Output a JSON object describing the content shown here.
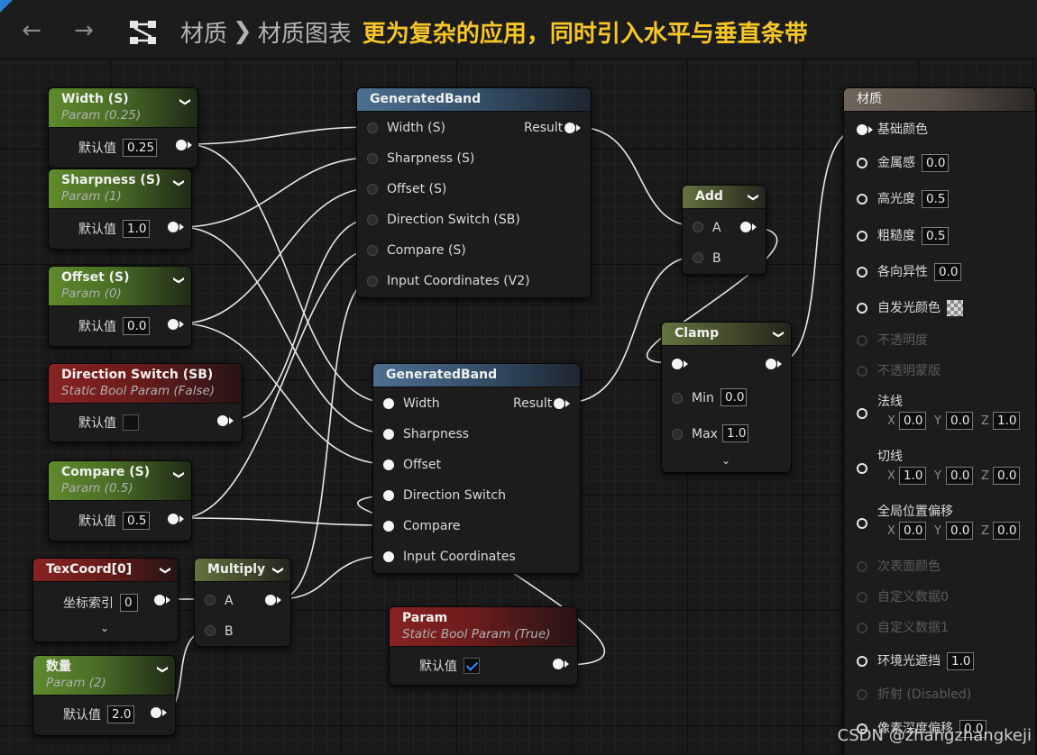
{
  "breadcrumb": {
    "root": "材质",
    "current": "材质图表",
    "caption": "更为复杂的应用，同时引入水平与垂直条带"
  },
  "nodes": {
    "width_param": {
      "title": "Width (S)",
      "subtitle": "Param (0.25)",
      "field_label": "默认值",
      "value": "0.25"
    },
    "sharpness_param": {
      "title": "Sharpness (S)",
      "subtitle": "Param (1)",
      "field_label": "默认值",
      "value": "1.0"
    },
    "offset_param": {
      "title": "Offset (S)",
      "subtitle": "Param (0)",
      "field_label": "默认值",
      "value": "0.0"
    },
    "direction_param": {
      "title": "Direction Switch (SB)",
      "subtitle": "Static Bool Param (False)",
      "field_label": "默认值",
      "checked": false
    },
    "compare_param": {
      "title": "Compare (S)",
      "subtitle": "Param (0.5)",
      "field_label": "默认值",
      "value": "0.5"
    },
    "texcoord": {
      "title": "TexCoord[0]",
      "field_label": "坐标索引",
      "value": "0"
    },
    "multiply": {
      "title": "Multiply",
      "pin_a": "A",
      "pin_b": "B"
    },
    "scalar_param": {
      "title": "数量",
      "subtitle": "Param (2)",
      "field_label": "默认值",
      "value": "2.0"
    },
    "band1": {
      "title": "GeneratedBand",
      "inputs": [
        "Width (S)",
        "Sharpness (S)",
        "Offset (S)",
        "Direction Switch (SB)",
        "Compare (S)",
        "Input Coordinates (V2)"
      ],
      "output": "Result"
    },
    "band2": {
      "title": "GeneratedBand",
      "inputs": [
        "Width",
        "Sharpness",
        "Offset",
        "Direction Switch",
        "Compare",
        "Input Coordinates"
      ],
      "output": "Result"
    },
    "static_bool": {
      "title": "Param",
      "subtitle": "Static Bool Param (True)",
      "field_label": "默认值",
      "checked": true
    },
    "add": {
      "title": "Add",
      "pin_a": "A",
      "pin_b": "B"
    },
    "clamp": {
      "title": "Clamp",
      "min_label": "Min",
      "min_value": "0.0",
      "max_label": "Max",
      "max_value": "1.0"
    },
    "material": {
      "title": "材质",
      "base_color": "基础颜色",
      "metallic": {
        "label": "金属感",
        "value": "0.0"
      },
      "specular": {
        "label": "高光度",
        "value": "0.5"
      },
      "roughness": {
        "label": "粗糙度",
        "value": "0.5"
      },
      "anisotropy": {
        "label": "各向异性",
        "value": "0.0"
      },
      "emissive": "自发光颜色",
      "opacity": "不透明度",
      "opacity_mask": "不透明蒙版",
      "normal": {
        "label": "法线",
        "x": "0.0",
        "y": "0.0",
        "z": "1.0"
      },
      "tangent": {
        "label": "切线",
        "x": "1.0",
        "y": "0.0",
        "z": "0.0"
      },
      "wpo": {
        "label": "全局位置偏移",
        "x": "0.0",
        "y": "0.0",
        "z": "0.0"
      },
      "subsurface": "次表面颜色",
      "custom0": "自定义数据0",
      "custom1": "自定义数据1",
      "ao": {
        "label": "环境光遮挡",
        "value": "1.0"
      },
      "refraction": "折射 (Disabled)",
      "pdo": {
        "label": "像素深度偏移",
        "value": "0.0"
      },
      "axis_x": "X",
      "axis_y": "Y",
      "axis_z": "Z"
    }
  },
  "watermark": "CSDN @zhangzhangkeji",
  "colors": {
    "caption": "#f6c627",
    "accent_blue": "#2a7fd4",
    "checkbox_blue": "#2f8cff"
  }
}
